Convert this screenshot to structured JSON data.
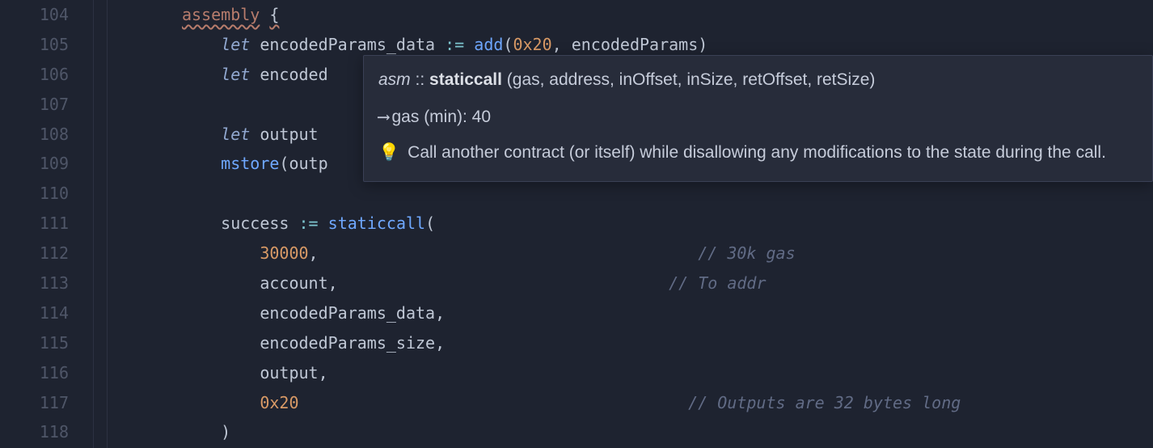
{
  "gutter": [
    "104",
    "105",
    "106",
    "107",
    "108",
    "109",
    "110",
    "111",
    "112",
    "113",
    "114",
    "115",
    "116",
    "117",
    "118"
  ],
  "code": {
    "l104": {
      "kw": "assembly",
      "brace": "{"
    },
    "l105": {
      "let": "let",
      "id": "encodedParams_data",
      "op": ":=",
      "fn": "add",
      "lp": "(",
      "arg1": "0x20",
      "comma": ",",
      "sp": " ",
      "arg2": "encodedParams",
      "rp": ")"
    },
    "l106": {
      "let": "let",
      "id": "encoded"
    },
    "l107": "",
    "l108": {
      "let": "let",
      "id": "output"
    },
    "l109": {
      "fn": "mstore",
      "lp": "(",
      "arg": "outp"
    },
    "l110": "",
    "l111": {
      "id": "success",
      "op": ":=",
      "fn": "staticcall",
      "lp": "("
    },
    "l112": {
      "num": "30000",
      "comma": ",",
      "comment": "// 30k gas"
    },
    "l113": {
      "id": "account",
      "comma": ",",
      "comment": "// To addr"
    },
    "l114": {
      "id": "encodedParams_data",
      "comma": ","
    },
    "l115": {
      "id": "encodedParams_size",
      "comma": ","
    },
    "l116": {
      "id": "output",
      "comma": ","
    },
    "l117": {
      "num": "0x20",
      "comment": "// Outputs are 32 bytes long"
    },
    "l118": {
      "rp": ")"
    }
  },
  "tooltip": {
    "ns": "asm",
    "sep": "::",
    "fn": "staticcall",
    "sig": "(gas, address, inOffset, inSize, retOffset, retSize)",
    "arrow": "⟶",
    "gas": "gas (min): 40",
    "bulb": "💡",
    "desc": "Call another contract (or itself) while disallowing any modifications to the state during the call."
  }
}
